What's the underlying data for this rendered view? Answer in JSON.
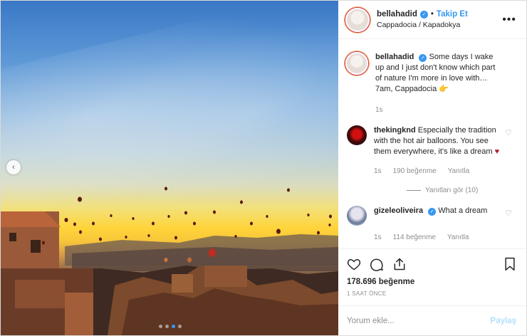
{
  "post": {
    "author": {
      "username": "bellahadid",
      "verified": true,
      "follow_label": "Takip Et",
      "location": "Cappadocia / Kapadokya"
    },
    "separator": "•",
    "more_label": "•••",
    "caption": {
      "username": "bellahadid",
      "text": "Some days I wake up and I just don't know which part of nature I'm more in love with… 7am, Cappadocia 👉",
      "time": "1s"
    },
    "comments": [
      {
        "username": "thekingknd",
        "text": "Especially the tradition with the hot air balloons. You see them everywhere, it's like a dream",
        "emoji": "♥",
        "time": "1s",
        "likes": "190 beğenme",
        "reply_label": "Yanıtla",
        "view_replies": "Yanıtları gör (10)"
      },
      {
        "username": "gizeleoliveira",
        "verified": true,
        "text": "What a dream",
        "time": "1s",
        "likes": "114 beğenme",
        "reply_label": "Yanıtla"
      }
    ],
    "likes_count": "178.696 beğenme",
    "time_ago": "1 SAAT ÖNCE",
    "comment_placeholder": "Yorum ekle...",
    "post_button": "Paylaş",
    "carousel": {
      "count": 4,
      "active": 3
    },
    "icons": {
      "like": "heart-icon",
      "comment": "comment-icon",
      "share": "share-icon",
      "save": "bookmark-icon",
      "prev": "chevron-left-icon"
    },
    "colors": {
      "accent": "#3897f0",
      "muted": "#8e8e8e",
      "text": "#262626"
    }
  }
}
